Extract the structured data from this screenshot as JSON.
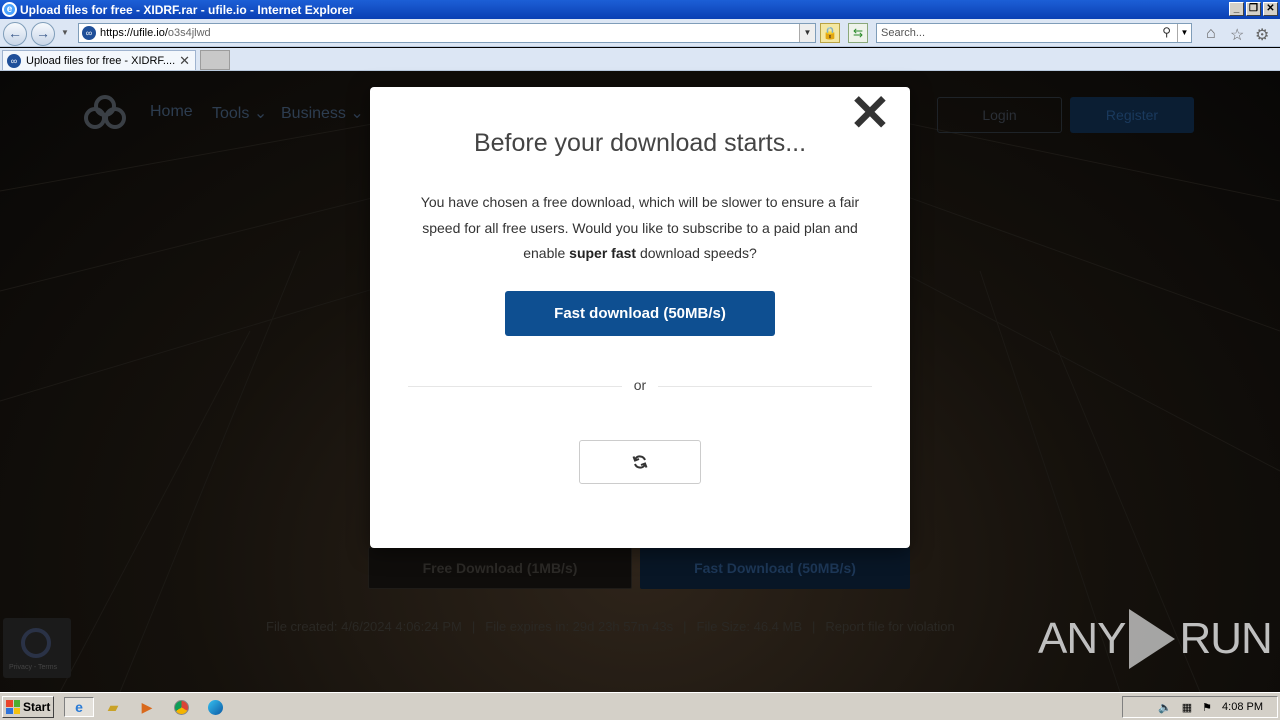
{
  "window": {
    "title": "Upload files for free - XIDRF.rar - ufile.io - Internet Explorer",
    "min_label": "_",
    "max_label": "❐",
    "close_label": "✕"
  },
  "browser": {
    "back_label": "←",
    "forward_label": "→",
    "url_host": "https://ufile.io/",
    "url_path": "o3s4jlwd",
    "search_placeholder": "Search...",
    "tab_title": "Upload files for free - XIDRF....",
    "tab_close_label": "✕"
  },
  "site": {
    "nav": [
      "Home",
      "Tools",
      "Business"
    ],
    "login_label": "Login",
    "register_label": "Register",
    "free_download_label": "Free Download (1MB/s)",
    "fast_download_label": "Fast Download (50MB/s)",
    "file_created": "File created: 4/6/2024 4:06:24 PM",
    "file_expires": "File expires in: 29d 23h 57m 43s",
    "file_size": "File Size: 46.4 MB",
    "report_label": "Report file for violation",
    "separator": "|",
    "recaptcha_text": "Privacy - Terms"
  },
  "modal": {
    "title": "Before your download starts...",
    "body_pre": "You have chosen a free download, which will be slower to ensure a fair speed for all free users. Would you like to subscribe to a paid plan and enable ",
    "body_bold": "super fast",
    "body_post": " download speeds?",
    "fast_button": "Fast download (50MB/s)",
    "or": "or",
    "close_label": "✕"
  },
  "watermark": {
    "left": "ANY",
    "right": "RUN"
  },
  "taskbar": {
    "start_label": "Start",
    "clock": "4:08 PM"
  },
  "colors": {
    "modal_button": "#0e4f91",
    "titlebar": "#1c5fd6"
  }
}
